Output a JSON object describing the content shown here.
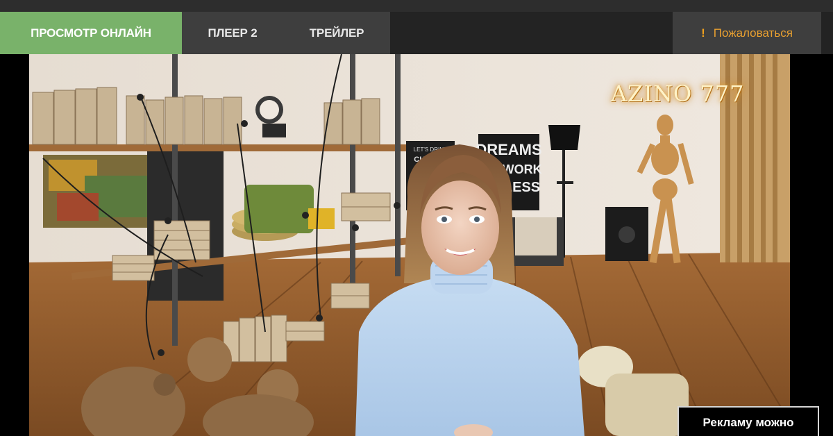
{
  "tabs": [
    {
      "label": "ПРОСМОТР ОНЛАЙН",
      "active": true
    },
    {
      "label": "ПЛЕЕР 2",
      "active": false
    },
    {
      "label": "ТРЕЙЛЕР",
      "active": false
    }
  ],
  "complain": {
    "icon": "!",
    "label": "Пожаловаться"
  },
  "video": {
    "watermark": "AZINO 777",
    "poster_lines": [
      "DREAMS",
      "'T WORK",
      "LESS"
    ],
    "poster_left": [
      "LET'S DRINK",
      "CHAMPA"
    ],
    "ad_label": "Рекламу можно"
  },
  "colors": {
    "active_tab": "#79b26a",
    "tab_bg": "#3e3e3e",
    "complain_text": "#e9a030"
  }
}
